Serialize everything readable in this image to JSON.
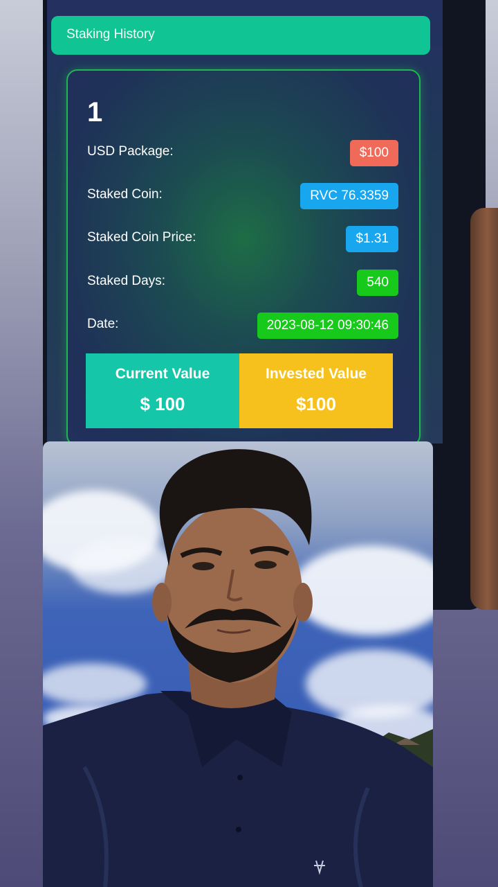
{
  "header": {
    "title": "Staking History"
  },
  "card": {
    "index": "1",
    "rows": [
      {
        "label": "USD Package:",
        "value": "$100",
        "color": "#f06a5a"
      },
      {
        "label": "Staked Coin:",
        "value": "RVC 76.3359",
        "color": "#18a6ef"
      },
      {
        "label": "Staked Coin Price:",
        "value": "$1.31",
        "color": "#18a6ef"
      },
      {
        "label": "Staked Days:",
        "value": "540",
        "color": "#16c91a"
      },
      {
        "label": "Date:",
        "value": "2023-08-12 09:30:46",
        "color": "#16c91a"
      }
    ],
    "current_value": {
      "title": "Current Value",
      "amount": "$ 100",
      "color": "#16c6a8"
    },
    "invested_value": {
      "title": "Invested Value",
      "amount": "$100",
      "color": "#f7c11d"
    }
  },
  "colors": {
    "header_bar": "#10c494",
    "card_border": "#1fb84e"
  }
}
